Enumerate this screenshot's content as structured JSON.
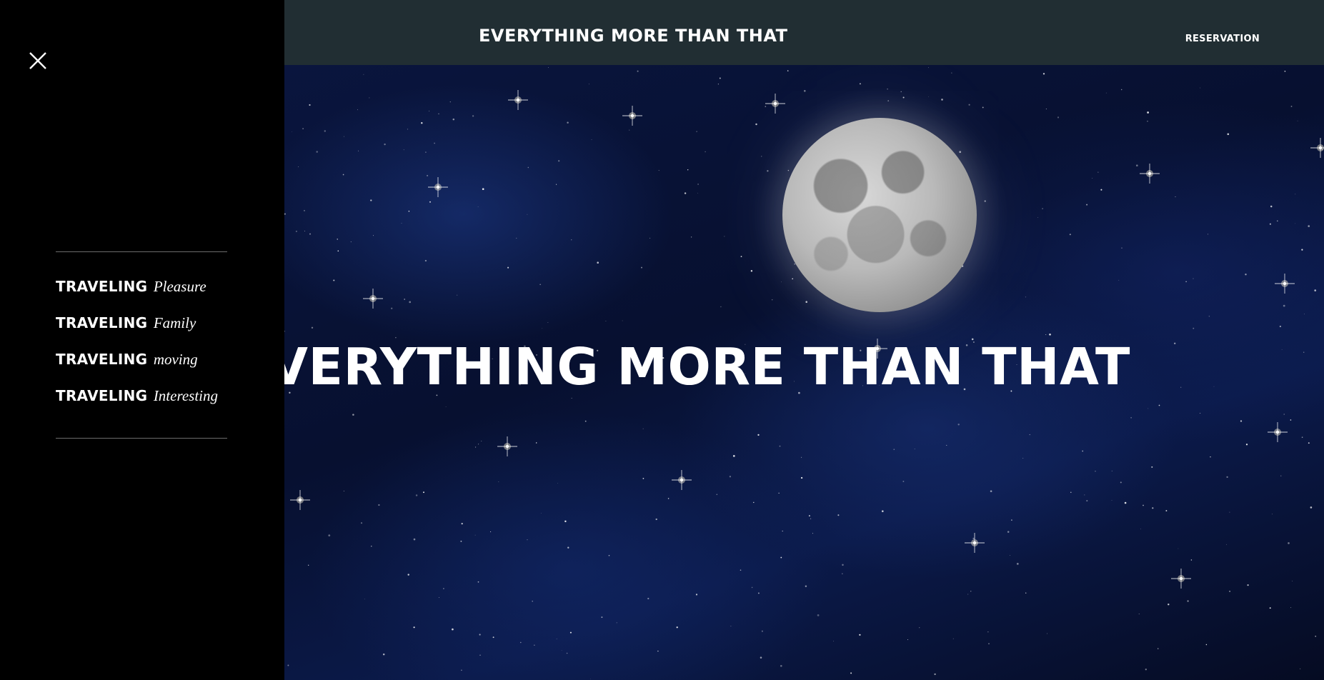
{
  "header": {
    "title": "EVERYTHING MORE THAN THAT",
    "reservation_label": "RESERVATION",
    "background_color": "#212e33"
  },
  "drawer": {
    "close_icon": "close-icon",
    "items": [
      {
        "strong": "TRAVELING",
        "em": "Pleasure"
      },
      {
        "strong": "TRAVELING",
        "em": "Family"
      },
      {
        "strong": "TRAVELING",
        "em": "moving"
      },
      {
        "strong": "TRAVELING",
        "em": "Interesting"
      }
    ]
  },
  "hero": {
    "title": "VERYTHING MORE THAN THAT",
    "background": "night sky with stars and full moon"
  }
}
